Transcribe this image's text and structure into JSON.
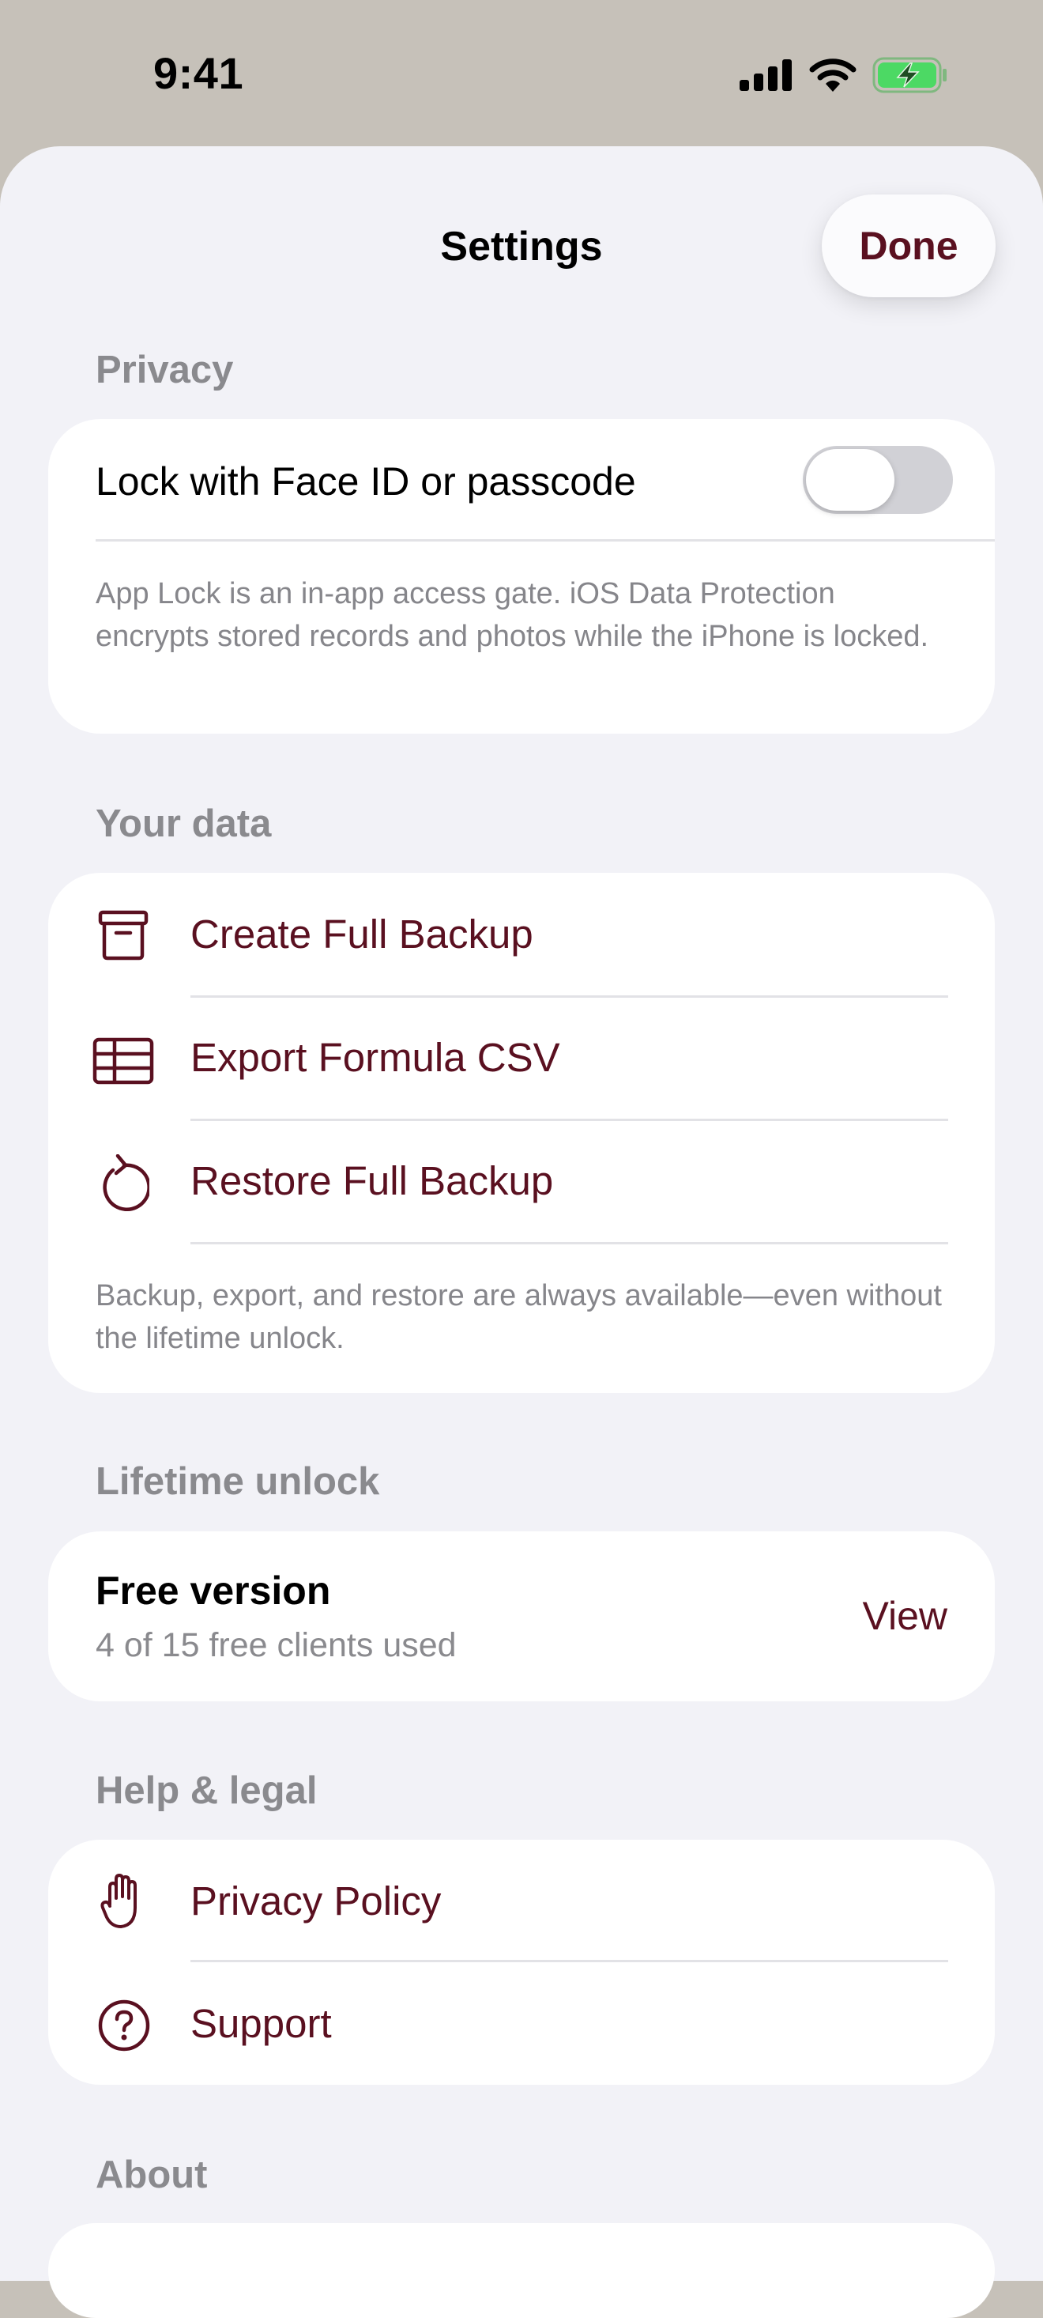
{
  "status_bar": {
    "time": "9:41"
  },
  "header": {
    "title": "Settings",
    "done_label": "Done"
  },
  "privacy": {
    "header": "Privacy",
    "lock_label": "Lock with Face ID or passcode",
    "lock_enabled": false,
    "footer": "App Lock is an in-app access gate. iOS Data Protection encrypts stored records and photos while the iPhone is locked."
  },
  "your_data": {
    "header": "Your data",
    "items": [
      {
        "label": "Create Full Backup",
        "icon": "archive-box-icon"
      },
      {
        "label": "Export Formula CSV",
        "icon": "table-icon"
      },
      {
        "label": "Restore Full Backup",
        "icon": "restore-arrow-icon"
      }
    ],
    "footer": "Backup, export, and restore are always available—even without the lifetime unlock."
  },
  "lifetime": {
    "header": "Lifetime unlock",
    "title": "Free version",
    "subtitle": "4 of 15 free clients used",
    "clients_used": 4,
    "clients_total": 15,
    "action": "View"
  },
  "help": {
    "header": "Help & legal",
    "items": [
      {
        "label": "Privacy Policy",
        "icon": "hand-raised-icon"
      },
      {
        "label": "Support",
        "icon": "question-circle-icon"
      }
    ]
  },
  "about": {
    "header": "About"
  },
  "colors": {
    "accent": "#5a1020",
    "background": "#f2f2f7",
    "secondary_text": "#8a8a8e",
    "battery_green": "#4cd964"
  }
}
